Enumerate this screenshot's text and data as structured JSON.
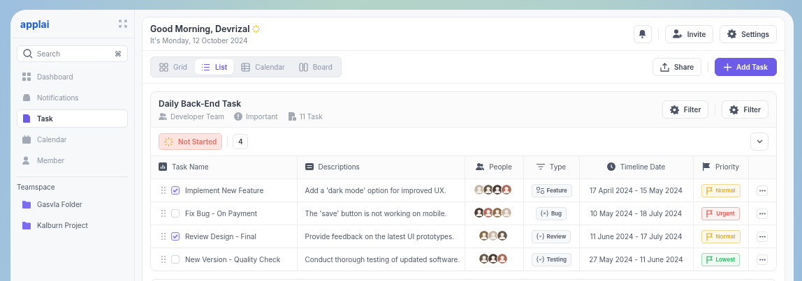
{
  "sidebar": {
    "logo": "applai",
    "search": {
      "placeholder": "Search",
      "shortcut": "⌘"
    },
    "items": [
      {
        "label": "Dashboard",
        "selected": false
      },
      {
        "label": "Notifications",
        "selected": false
      },
      {
        "label": "Task",
        "selected": true
      },
      {
        "label": "Calendar",
        "selected": false
      },
      {
        "label": "Member",
        "selected": false
      }
    ],
    "section": "Teamspace",
    "folders": [
      "Gasvla Folder",
      "Kalburn Project"
    ]
  },
  "header": {
    "greeting": "Good Morning, Devrizal",
    "date": "It's Monday, 12 October 2024",
    "buttons": [
      "Invite",
      "Settings"
    ]
  },
  "views": [
    {
      "label": "Grid",
      "selected": false
    },
    {
      "label": "List",
      "selected": true
    },
    {
      "label": "Calendar",
      "selected": false
    },
    {
      "label": "Board",
      "selected": false
    }
  ],
  "actions": {
    "share": "Share",
    "add": "Add Task"
  },
  "card": {
    "title": "Daily Back-End Task",
    "meta": [
      "Developer Team",
      "Important",
      "11 Task"
    ],
    "filters": [
      "Filter",
      "Filter"
    ],
    "status": {
      "label": "Not Started",
      "count": "4"
    },
    "columns": [
      "Task Name",
      "Descriptions",
      "People",
      "Type",
      "Timeline Date",
      "Priority"
    ],
    "rows": [
      {
        "name": "Implement New Feature",
        "checked": true,
        "description": "Add a 'dark mode' option for improved UX.",
        "people": [
          {
            "kind": "avatar"
          },
          {
            "kind": "avatar"
          },
          {
            "kind": "avatar"
          },
          {
            "kind": "avatar"
          }
        ],
        "type": {
          "kind": "feature",
          "label": "Feature"
        },
        "timeline": "17 April 2024 - 15 May 2024",
        "priority": {
          "label": "Normal",
          "color": "#e8a912"
        }
      },
      {
        "name": "Fix Bug - On Payment",
        "checked": false,
        "description": "The 'save' button is not working on mobile.",
        "people": [
          {
            "kind": "avatar"
          },
          {
            "kind": "avatar"
          },
          {
            "kind": "avatar"
          },
          {
            "kind": "avatar"
          }
        ],
        "type": {
          "kind": "bug",
          "label": "Bug"
        },
        "timeline": "10 May 2024 - 18 July 2024",
        "priority": {
          "label": "Urgent",
          "color": "#e5534b"
        }
      },
      {
        "name": "Review Design - Final",
        "checked": true,
        "description": "Provide feedback on the latest UI prototypes.",
        "people": [
          {
            "kind": "avatar"
          },
          {
            "kind": "avatar"
          },
          {
            "kind": "avatar"
          }
        ],
        "type": {
          "kind": "review",
          "label": "Review"
        },
        "timeline": "11 June 2024 - 17 July 2024",
        "priority": {
          "label": "Normal",
          "color": "#e8a912"
        }
      },
      {
        "name": "New Version - Quality Check",
        "checked": false,
        "description": "Conduct thorough testing of updated software.",
        "people": [
          {
            "kind": "avatar"
          },
          {
            "kind": "avatar"
          },
          {
            "kind": "avatar"
          }
        ],
        "type": {
          "kind": "testing",
          "label": "Testing"
        },
        "timeline": "27 May 2024 - 11 June 2024",
        "priority": {
          "label": "Lowest",
          "color": "#22b45e"
        }
      }
    ]
  }
}
